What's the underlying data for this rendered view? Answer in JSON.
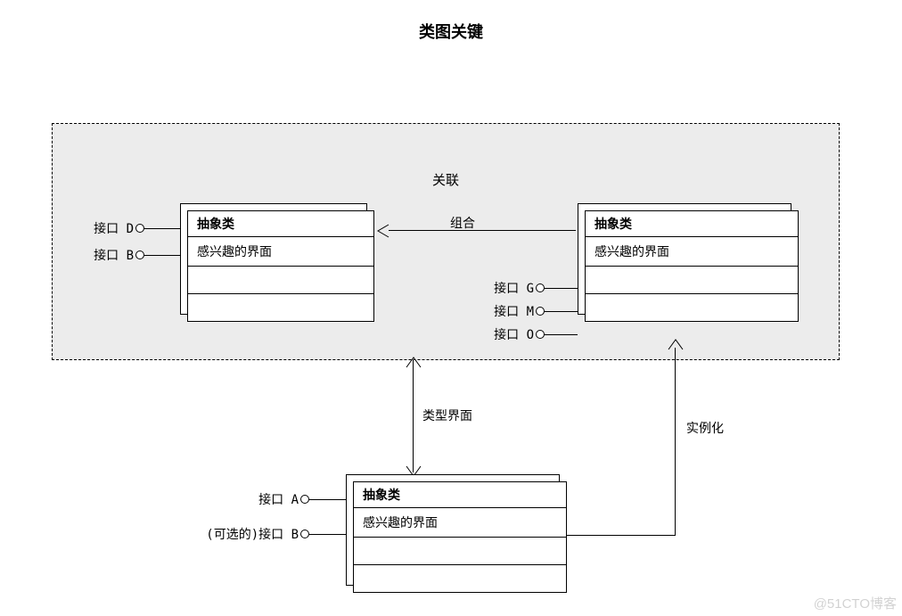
{
  "title": "类图关键",
  "watermark": "@51CTO博客",
  "association": {
    "label": "关联"
  },
  "classLeft": {
    "header": "抽象类",
    "section1": "感兴趣的界面",
    "interfaces": [
      {
        "label": "接口 D"
      },
      {
        "label": "接口 B"
      }
    ]
  },
  "classRight": {
    "header": "抽象类",
    "section1": "感兴趣的界面",
    "interfaces": [
      {
        "label": "接口 G"
      },
      {
        "label": "接口 M"
      },
      {
        "label": "接口 O"
      }
    ]
  },
  "classBottom": {
    "header": "抽象类",
    "section1": "感兴趣的界面",
    "interfaces": [
      {
        "label": "接口 A"
      },
      {
        "label": "(可选的)接口 B"
      }
    ]
  },
  "edges": {
    "compose": "组合",
    "typeInterface": "类型界面",
    "instantiate": "实例化"
  }
}
